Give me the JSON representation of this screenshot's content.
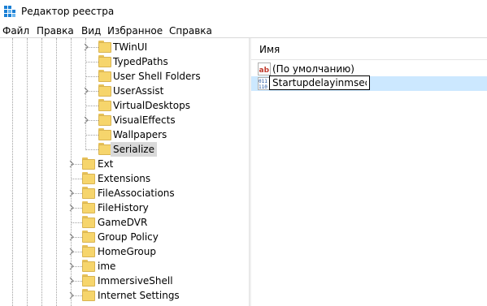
{
  "window": {
    "title": "Редактор реестра",
    "icon": "registry-editor-icon"
  },
  "menu": [
    "Файл",
    "Правка",
    "Вид",
    "Избранное",
    "Справка"
  ],
  "tree": {
    "items": [
      {
        "label": "TWinUI",
        "expandable": true
      },
      {
        "label": "TypedPaths",
        "expandable": false
      },
      {
        "label": "User Shell Folders",
        "expandable": false
      },
      {
        "label": "UserAssist",
        "expandable": true
      },
      {
        "label": "VirtualDesktops",
        "expandable": false
      },
      {
        "label": "VisualEffects",
        "expandable": true
      },
      {
        "label": "Wallpapers",
        "expandable": false
      },
      {
        "label": "Serialize",
        "expandable": false,
        "selected": true
      },
      {
        "label": "Ext",
        "expandable": true
      },
      {
        "label": "Extensions",
        "expandable": false
      },
      {
        "label": "FileAssociations",
        "expandable": true
      },
      {
        "label": "FileHistory",
        "expandable": true
      },
      {
        "label": "GameDVR",
        "expandable": false
      },
      {
        "label": "Group Policy",
        "expandable": true
      },
      {
        "label": "HomeGroup",
        "expandable": true
      },
      {
        "label": "ime",
        "expandable": true
      },
      {
        "label": "ImmersiveShell",
        "expandable": true
      },
      {
        "label": "Internet Settings",
        "expandable": true
      }
    ]
  },
  "values_pane": {
    "column_header": "Имя",
    "rows": [
      {
        "icon": "string-value-icon",
        "name": "(По умолчанию)"
      },
      {
        "icon": "dword-value-icon",
        "name": "Startupdelayinmsec",
        "editing": true
      }
    ]
  },
  "colors": {
    "selection_blue": "#cce8ff",
    "folder_yellow": "#f6d56c"
  }
}
